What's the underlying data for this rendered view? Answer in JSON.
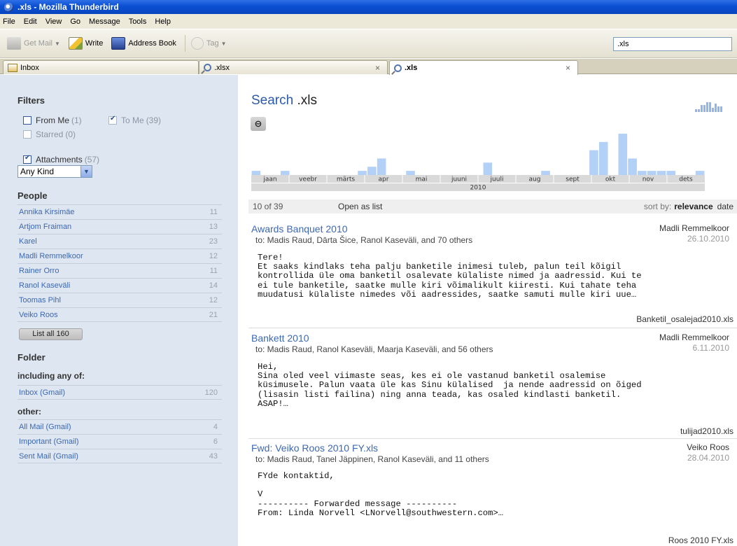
{
  "window": {
    "title": ".xls - Mozilla Thunderbird"
  },
  "menu": [
    "File",
    "Edit",
    "View",
    "Go",
    "Message",
    "Tools",
    "Help"
  ],
  "toolbar": {
    "get_mail": "Get Mail",
    "write": "Write",
    "address_book": "Address Book",
    "tag": "Tag",
    "search_value": ".xls"
  },
  "tabs": [
    {
      "label": "Inbox"
    },
    {
      "label": ".xlsx"
    },
    {
      "label": ".xls"
    }
  ],
  "filters": {
    "heading": "Filters",
    "from_me": {
      "label": "From Me",
      "count": "(1)"
    },
    "to_me": {
      "label": "To Me",
      "count": "(39)"
    },
    "starred": {
      "label": "Starred",
      "count": "(0)"
    },
    "attachments": {
      "label": "Attachments",
      "count": "(57)"
    },
    "kind": "Any Kind"
  },
  "people": {
    "heading": "People",
    "items": [
      {
        "name": "Annika Kirsimäe",
        "count": "11"
      },
      {
        "name": "Artjom Fraiman",
        "count": "13"
      },
      {
        "name": "Karel",
        "count": "23"
      },
      {
        "name": "Madli Remmelkoor",
        "count": "12"
      },
      {
        "name": "Rainer Orro",
        "count": "11"
      },
      {
        "name": "Ranol Kaseväli",
        "count": "14"
      },
      {
        "name": "Toomas Pihl",
        "count": "12"
      },
      {
        "name": "Veiko Roos",
        "count": "21"
      }
    ],
    "list_all": "List all 160"
  },
  "folder": {
    "heading": "Folder",
    "including_label": "including any of:",
    "including": [
      {
        "name": "Inbox (Gmail)",
        "count": "120"
      }
    ],
    "other_label": "other:",
    "other": [
      {
        "name": "All Mail (Gmail)",
        "count": "4"
      },
      {
        "name": "Important (Gmail)",
        "count": "6"
      },
      {
        "name": "Sent Mail (Gmail)",
        "count": "43"
      }
    ]
  },
  "search": {
    "prefix": "Search",
    "term": ".xls",
    "count_text": "10 of 39",
    "open_as_list": "Open as list",
    "sort_label": "sort by:",
    "sort_relevance": "relevance",
    "sort_date": "date"
  },
  "timeline": {
    "year": "2010",
    "months": [
      "jaan",
      "veebr",
      "märts",
      "apr",
      "mai",
      "juuni",
      "juuli",
      "aug",
      "sept",
      "okt",
      "nov",
      "dets"
    ],
    "bars": [
      1,
      0,
      0,
      1,
      0,
      0,
      0,
      0,
      0,
      0,
      0,
      1,
      2,
      4,
      0,
      0,
      1,
      0,
      0,
      0,
      0,
      0,
      0,
      0,
      3,
      0,
      0,
      0,
      0,
      0,
      1,
      0,
      0,
      0,
      0,
      6,
      8,
      0,
      10,
      4,
      1,
      1,
      1,
      1,
      0,
      0,
      1
    ],
    "spark": [
      2,
      2,
      5,
      5,
      7,
      7,
      3,
      6,
      4,
      4
    ]
  },
  "messages": [
    {
      "subject": "Awards Banquet 2010",
      "to": "to: Madis Raud, Dārta Šice, Ranol Kaseväli, and 70 others",
      "from": "Madli Remmelkoor",
      "date": "26.10.2010",
      "body": "Tere!\nEt saaks kindlaks teha palju banketile inimesi tuleb, palun teil kõigil\nkontrollida üle oma banketil osalevate külaliste nimed ja aadressid. Kui te\nei tule banketile, saatke mulle kiri võimalikult kiiresti. Kui tahate teha\nmuudatusi külaliste nimedes või aadressides, saatke samuti mulle kiri uue…",
      "attachment": "Banketil_osalejad2010.xls"
    },
    {
      "subject": "Bankett 2010",
      "to": "to: Madis Raud, Ranol Kaseväli, Maarja Kaseväli, and 56 others",
      "from": "Madli Remmelkoor",
      "date": "6.11.2010",
      "body": "Hei,\nSina oled veel viimaste seas, kes ei ole vastanud banketil osalemise\nküsimusele. Palun vaata üle kas Sinu külalised  ja nende aadressid on õiged\n(lisasin listi failina) ning anna teada, kas osaled kindlasti banketil.\nASAP!…",
      "attachment": "tulijad2010.xls"
    },
    {
      "subject": "Fwd: Veiko Roos 2010 FY.xls",
      "to": "to: Madis Raud, Tanel Jäppinen, Ranol Kaseväli, and 11 others",
      "from": "Veiko Roos",
      "date": "28.04.2010",
      "body": "FYde kontaktid,\n\nV\n---------- Forwarded message ----------\nFrom: Linda Norvell <LNorvell@southwestern.com>…",
      "attachment": "Roos 2010 FY.xls"
    }
  ]
}
